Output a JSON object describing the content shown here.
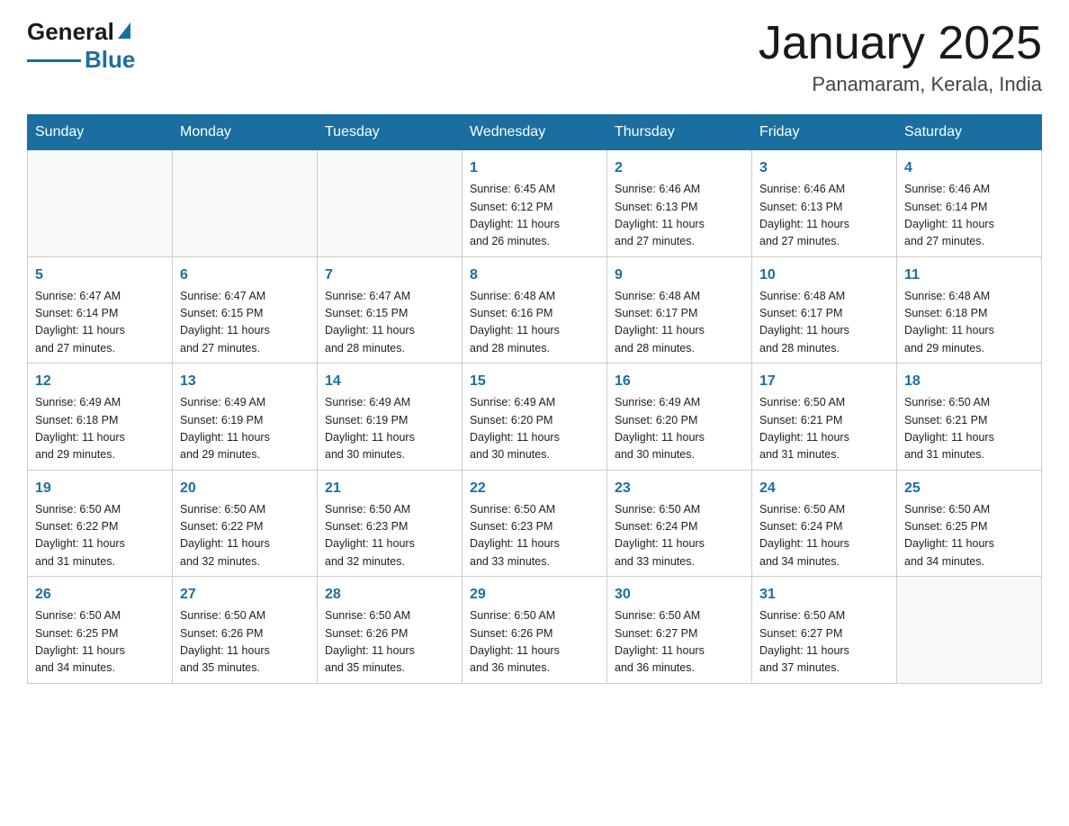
{
  "header": {
    "logo": {
      "general": "General",
      "blue": "Blue"
    },
    "title": "January 2025",
    "subtitle": "Panamaram, Kerala, India"
  },
  "days_of_week": [
    "Sunday",
    "Monday",
    "Tuesday",
    "Wednesday",
    "Thursday",
    "Friday",
    "Saturday"
  ],
  "weeks": [
    [
      {
        "day": "",
        "info": ""
      },
      {
        "day": "",
        "info": ""
      },
      {
        "day": "",
        "info": ""
      },
      {
        "day": "1",
        "info": "Sunrise: 6:45 AM\nSunset: 6:12 PM\nDaylight: 11 hours\nand 26 minutes."
      },
      {
        "day": "2",
        "info": "Sunrise: 6:46 AM\nSunset: 6:13 PM\nDaylight: 11 hours\nand 27 minutes."
      },
      {
        "day": "3",
        "info": "Sunrise: 6:46 AM\nSunset: 6:13 PM\nDaylight: 11 hours\nand 27 minutes."
      },
      {
        "day": "4",
        "info": "Sunrise: 6:46 AM\nSunset: 6:14 PM\nDaylight: 11 hours\nand 27 minutes."
      }
    ],
    [
      {
        "day": "5",
        "info": "Sunrise: 6:47 AM\nSunset: 6:14 PM\nDaylight: 11 hours\nand 27 minutes."
      },
      {
        "day": "6",
        "info": "Sunrise: 6:47 AM\nSunset: 6:15 PM\nDaylight: 11 hours\nand 27 minutes."
      },
      {
        "day": "7",
        "info": "Sunrise: 6:47 AM\nSunset: 6:15 PM\nDaylight: 11 hours\nand 28 minutes."
      },
      {
        "day": "8",
        "info": "Sunrise: 6:48 AM\nSunset: 6:16 PM\nDaylight: 11 hours\nand 28 minutes."
      },
      {
        "day": "9",
        "info": "Sunrise: 6:48 AM\nSunset: 6:17 PM\nDaylight: 11 hours\nand 28 minutes."
      },
      {
        "day": "10",
        "info": "Sunrise: 6:48 AM\nSunset: 6:17 PM\nDaylight: 11 hours\nand 28 minutes."
      },
      {
        "day": "11",
        "info": "Sunrise: 6:48 AM\nSunset: 6:18 PM\nDaylight: 11 hours\nand 29 minutes."
      }
    ],
    [
      {
        "day": "12",
        "info": "Sunrise: 6:49 AM\nSunset: 6:18 PM\nDaylight: 11 hours\nand 29 minutes."
      },
      {
        "day": "13",
        "info": "Sunrise: 6:49 AM\nSunset: 6:19 PM\nDaylight: 11 hours\nand 29 minutes."
      },
      {
        "day": "14",
        "info": "Sunrise: 6:49 AM\nSunset: 6:19 PM\nDaylight: 11 hours\nand 30 minutes."
      },
      {
        "day": "15",
        "info": "Sunrise: 6:49 AM\nSunset: 6:20 PM\nDaylight: 11 hours\nand 30 minutes."
      },
      {
        "day": "16",
        "info": "Sunrise: 6:49 AM\nSunset: 6:20 PM\nDaylight: 11 hours\nand 30 minutes."
      },
      {
        "day": "17",
        "info": "Sunrise: 6:50 AM\nSunset: 6:21 PM\nDaylight: 11 hours\nand 31 minutes."
      },
      {
        "day": "18",
        "info": "Sunrise: 6:50 AM\nSunset: 6:21 PM\nDaylight: 11 hours\nand 31 minutes."
      }
    ],
    [
      {
        "day": "19",
        "info": "Sunrise: 6:50 AM\nSunset: 6:22 PM\nDaylight: 11 hours\nand 31 minutes."
      },
      {
        "day": "20",
        "info": "Sunrise: 6:50 AM\nSunset: 6:22 PM\nDaylight: 11 hours\nand 32 minutes."
      },
      {
        "day": "21",
        "info": "Sunrise: 6:50 AM\nSunset: 6:23 PM\nDaylight: 11 hours\nand 32 minutes."
      },
      {
        "day": "22",
        "info": "Sunrise: 6:50 AM\nSunset: 6:23 PM\nDaylight: 11 hours\nand 33 minutes."
      },
      {
        "day": "23",
        "info": "Sunrise: 6:50 AM\nSunset: 6:24 PM\nDaylight: 11 hours\nand 33 minutes."
      },
      {
        "day": "24",
        "info": "Sunrise: 6:50 AM\nSunset: 6:24 PM\nDaylight: 11 hours\nand 34 minutes."
      },
      {
        "day": "25",
        "info": "Sunrise: 6:50 AM\nSunset: 6:25 PM\nDaylight: 11 hours\nand 34 minutes."
      }
    ],
    [
      {
        "day": "26",
        "info": "Sunrise: 6:50 AM\nSunset: 6:25 PM\nDaylight: 11 hours\nand 34 minutes."
      },
      {
        "day": "27",
        "info": "Sunrise: 6:50 AM\nSunset: 6:26 PM\nDaylight: 11 hours\nand 35 minutes."
      },
      {
        "day": "28",
        "info": "Sunrise: 6:50 AM\nSunset: 6:26 PM\nDaylight: 11 hours\nand 35 minutes."
      },
      {
        "day": "29",
        "info": "Sunrise: 6:50 AM\nSunset: 6:26 PM\nDaylight: 11 hours\nand 36 minutes."
      },
      {
        "day": "30",
        "info": "Sunrise: 6:50 AM\nSunset: 6:27 PM\nDaylight: 11 hours\nand 36 minutes."
      },
      {
        "day": "31",
        "info": "Sunrise: 6:50 AM\nSunset: 6:27 PM\nDaylight: 11 hours\nand 37 minutes."
      },
      {
        "day": "",
        "info": ""
      }
    ]
  ]
}
